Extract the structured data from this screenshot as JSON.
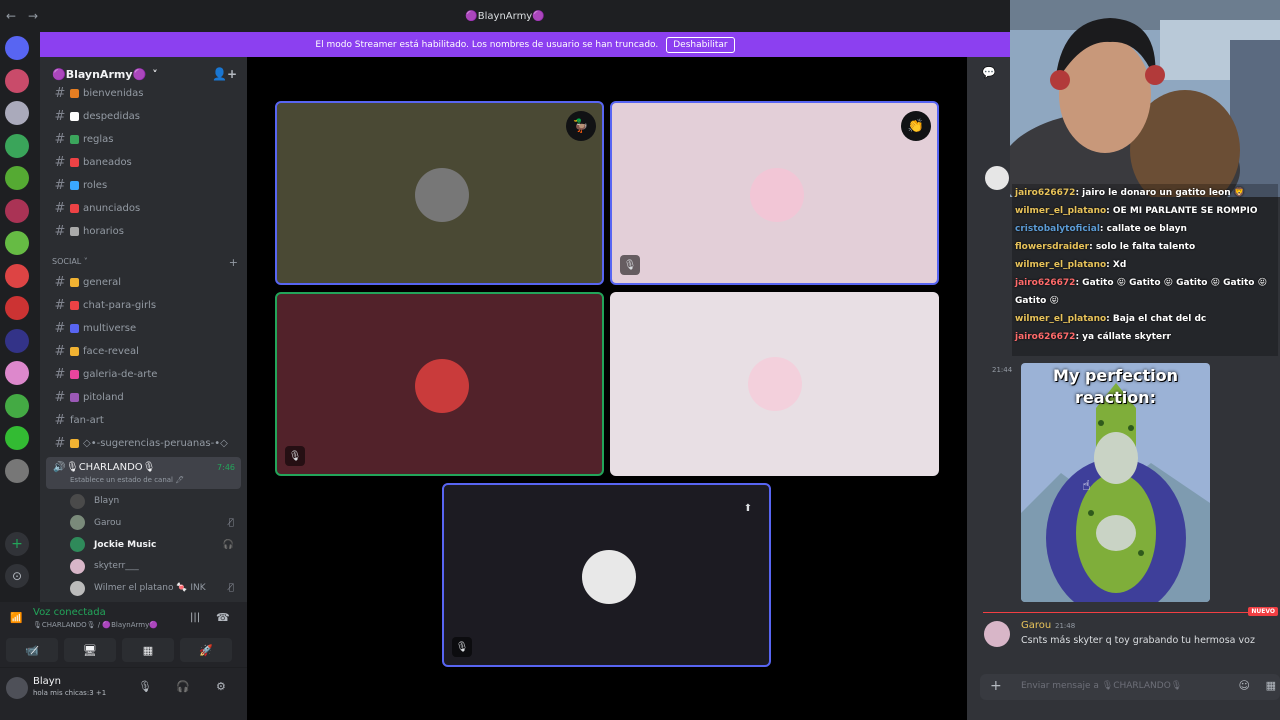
{
  "window": {
    "title": "🟣BlaynArmy🟣",
    "back": "←",
    "forward": "→"
  },
  "banner": {
    "text": "El modo Streamer está habilitado. Los nombres de usuario se han truncado.",
    "button": "Deshabilitar"
  },
  "server": {
    "name": "🟣BlaynArmy🟣",
    "chevron": "˅",
    "add_icon": "👤+"
  },
  "channels_top": [
    {
      "label": "bienvenidas",
      "emoji_color": "#e67e22"
    },
    {
      "label": "despedidas",
      "emoji_color": "#ffffff"
    },
    {
      "label": "reglas",
      "emoji_color": "#3ba55c"
    },
    {
      "label": "baneados",
      "emoji_color": "#ed4245"
    },
    {
      "label": "roles",
      "emoji_color": "#3aa7ff"
    },
    {
      "label": "anunciados",
      "emoji_color": "#ed4245"
    },
    {
      "label": "horarios",
      "emoji_color": "#aaaaaa"
    }
  ],
  "category_social": {
    "label": "SOCIAL",
    "chevron": "˅",
    "plus": "+"
  },
  "channels_social": [
    {
      "label": "general",
      "emoji_color": "#f0b232"
    },
    {
      "label": "chat-para-girls",
      "emoji_color": "#ed4245"
    },
    {
      "label": "multiverse",
      "emoji_color": "#5865f2"
    },
    {
      "label": "face-reveal",
      "emoji_color": "#f0b232"
    },
    {
      "label": "galeria-de-arte",
      "emoji_color": "#eb459e"
    },
    {
      "label": "pitoland",
      "emoji_color": "#9b59b6"
    },
    {
      "label": "fan-art",
      "emoji_color": ""
    },
    {
      "label": "◇•-sugerencias-peruanas-•◇",
      "emoji_color": "#f0b232"
    }
  ],
  "voice_channel": {
    "name": "🎙CHARLANDO🎙",
    "time": "7:46",
    "status": "Establece un estado de canal 🖊",
    "speaker_icon": "🔊"
  },
  "voice_users": [
    {
      "name": "Blayn",
      "color": "#4a4a4a",
      "indicator": ""
    },
    {
      "name": "Garou",
      "color": "#7a8a7a",
      "indicator": "🎙̸"
    },
    {
      "name": "Jockie Music",
      "color": "#2f8a5a",
      "indicator": "🎧"
    },
    {
      "name": "skyterr___",
      "color": "#d8b6c8",
      "indicator": ""
    },
    {
      "name": "Wilmer el platano 🍬 INK",
      "color": "#bbbbbb",
      "indicator": "🎙̸"
    }
  ],
  "voice_panel": {
    "label": "Voz conectada",
    "sub": "🎙CHARLANDO🎙 / 🟣BlaynArmy🟣",
    "buttons": [
      "📹̸",
      "🖥",
      "▦",
      "🚀"
    ],
    "signal_icon": "📶"
  },
  "user_panel": {
    "name": "Blayn",
    "status": "hola mis chicas:3 +1",
    "mic": "🎙",
    "headset": "🎧",
    "settings": "⚙"
  },
  "tiles": [
    {
      "name": "tile-1",
      "bg": "#4a4934",
      "avatar_color": "#777",
      "badge": "🦆",
      "muted": false
    },
    {
      "name": "tile-2",
      "bg": "#e3cfd8",
      "avatar_color": "#f2c6d6",
      "badge": "👏",
      "muted": true
    },
    {
      "name": "tile-3",
      "bg": "#52222a",
      "avatar_color": "#c93b3b",
      "badge": "",
      "muted": true
    },
    {
      "name": "tile-4",
      "bg": "#e8dfe4",
      "avatar_color": "#f3d0dc",
      "badge": "",
      "muted": false
    },
    {
      "name": "tile-5",
      "bg": "#1c1b22",
      "avatar_color": "#e8e8e8",
      "badge": "⬆",
      "muted": true
    }
  ],
  "overlay_chat": [
    {
      "user": "jairo626672",
      "color": "#e8c35a",
      "text": ": jairo le donaro un gatito leon 🦁"
    },
    {
      "user": "wilmer_el_platano",
      "color": "#e8c35a",
      "text": ": OE MI PARLANTE SE ROMPIO"
    },
    {
      "user": "cristobalytoficial",
      "color": "#5b9bd5",
      "text": ": callate oe blayn"
    },
    {
      "user": "flowersdraider",
      "color": "#e8c35a",
      "text": ": solo le falta talento"
    },
    {
      "user": "wilmer_el_platano",
      "color": "#e8c35a",
      "text": ": Xd"
    },
    {
      "user": "jairo626672",
      "color": "#ff6b6b",
      "text": ": Gatito 😝 Gatito 😝 Gatito 😝 Gatito 😝 Gatito 😝"
    },
    {
      "user": "wilmer_el_platano",
      "color": "#e8c35a",
      "text": ": Baja el chat del dc"
    },
    {
      "user": "jairo626672",
      "color": "#ff6b6b",
      "text": ": ya cállate skyterr"
    }
  ],
  "message_time": "21:44",
  "meme_caption": "My perfection reaction:",
  "new_label": "NUEVO",
  "last_message": {
    "author": "Garou",
    "time": "21:48",
    "text": "Csnts más skyter q toy grabando tu hermosa voz"
  },
  "composer": {
    "placeholder": "Enviar mensaje a 🎙CHARLANDO🎙",
    "plus": "+",
    "emoji": "☺",
    "apps": "▦"
  }
}
